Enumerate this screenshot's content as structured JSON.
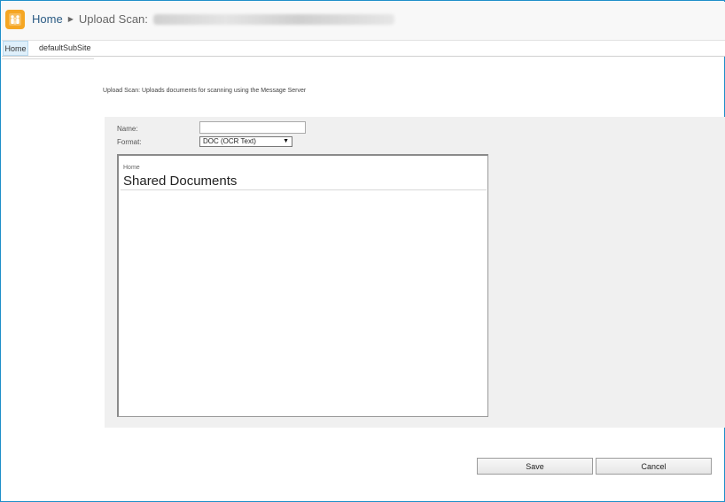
{
  "header": {
    "home_link": "Home",
    "page_title": "Upload Scan:"
  },
  "topnav": {
    "home_tab": "Home",
    "subsite_tab": "defaultSubSite"
  },
  "description": "Upload Scan: Uploads documents for scanning using the Message Server",
  "form": {
    "name_label": "Name:",
    "name_value": "",
    "format_label": "Format:",
    "format_value": "DOC (OCR Text)"
  },
  "library": {
    "breadcrumb": "Home",
    "title": "Shared Documents"
  },
  "buttons": {
    "save": "Save",
    "cancel": "Cancel"
  },
  "colors": {
    "frame_border": "#1f8fc9",
    "logo": "#f5a623",
    "home_link": "#2a5b84",
    "active_tab_bg": "#dff0fb",
    "panel_bg": "#f0f0f0"
  },
  "icons": {
    "app_logo": "people-logo-icon",
    "breadcrumb_separator": "chevron-right-icon",
    "select_arrow": "dropdown-arrow-icon"
  }
}
